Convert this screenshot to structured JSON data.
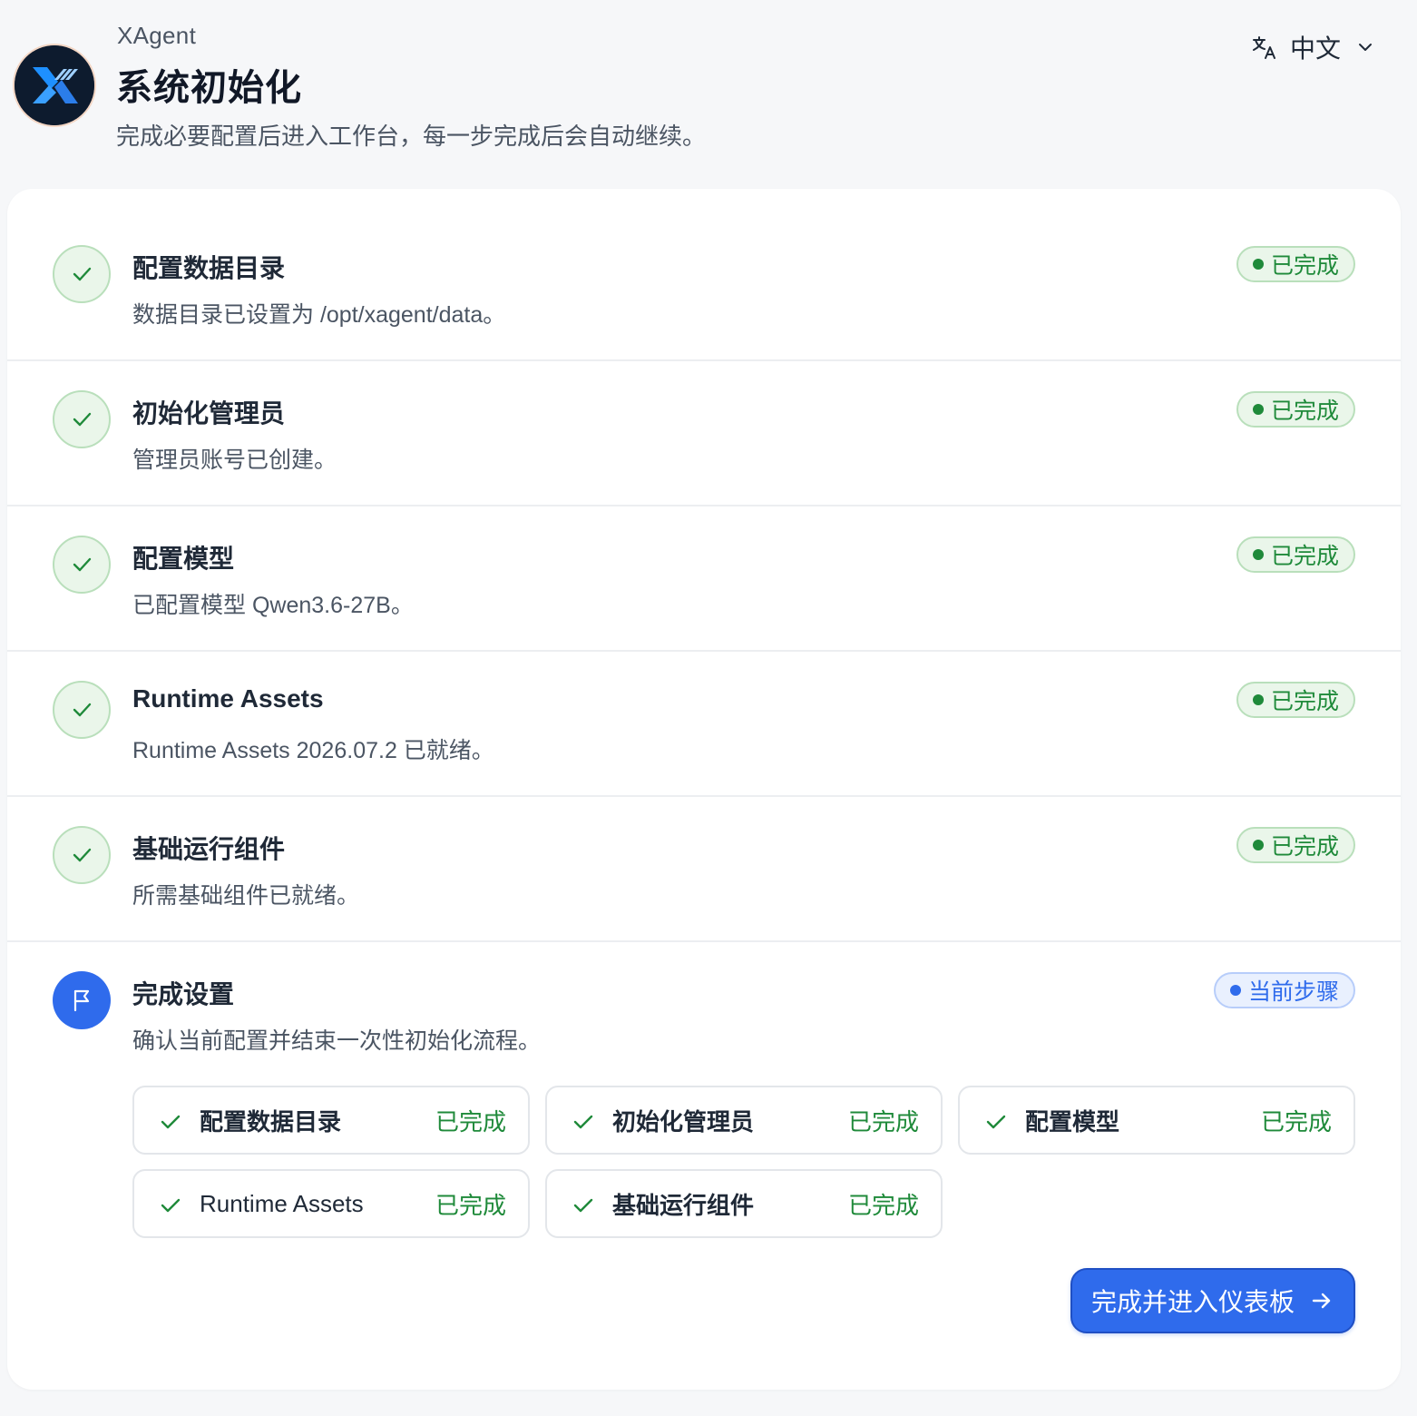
{
  "header": {
    "app_name": "XAgent",
    "title": "系统初始化",
    "subtitle": "完成必要配置后进入工作台，每一步完成后会自动继续。",
    "language": "中文"
  },
  "colors": {
    "primary": "#2f6bec",
    "success": "#1f8a3a",
    "success_bg": "#eaf6ea",
    "page_bg": "#f6f7f9"
  },
  "steps": [
    {
      "title": "配置数据目录",
      "description": "数据目录已设置为 /opt/xagent/data。",
      "status": "已完成",
      "icon": "check-icon"
    },
    {
      "title": "初始化管理员",
      "description": "管理员账号已创建。",
      "status": "已完成",
      "icon": "check-icon"
    },
    {
      "title": "配置模型",
      "description": "已配置模型 Qwen3.6-27B。",
      "status": "已完成",
      "icon": "check-icon"
    },
    {
      "title": "Runtime Assets",
      "description": "Runtime Assets 2026.07.2 已就绪。",
      "status": "已完成",
      "icon": "check-icon"
    },
    {
      "title": "基础运行组件",
      "description": "所需基础组件已就绪。",
      "status": "已完成",
      "icon": "check-icon"
    },
    {
      "title": "完成设置",
      "description": "确认当前配置并结束一次性初始化流程。",
      "status": "当前步骤",
      "icon": "flag-icon"
    }
  ],
  "summary": [
    {
      "label": "配置数据目录",
      "status": "已完成"
    },
    {
      "label": "初始化管理员",
      "status": "已完成"
    },
    {
      "label": "配置模型",
      "status": "已完成"
    },
    {
      "label": "Runtime Assets",
      "status": "已完成"
    },
    {
      "label": "基础运行组件",
      "status": "已完成"
    }
  ],
  "finish_button": {
    "label": "完成并进入仪表板",
    "icon": "arrow-right-icon"
  }
}
